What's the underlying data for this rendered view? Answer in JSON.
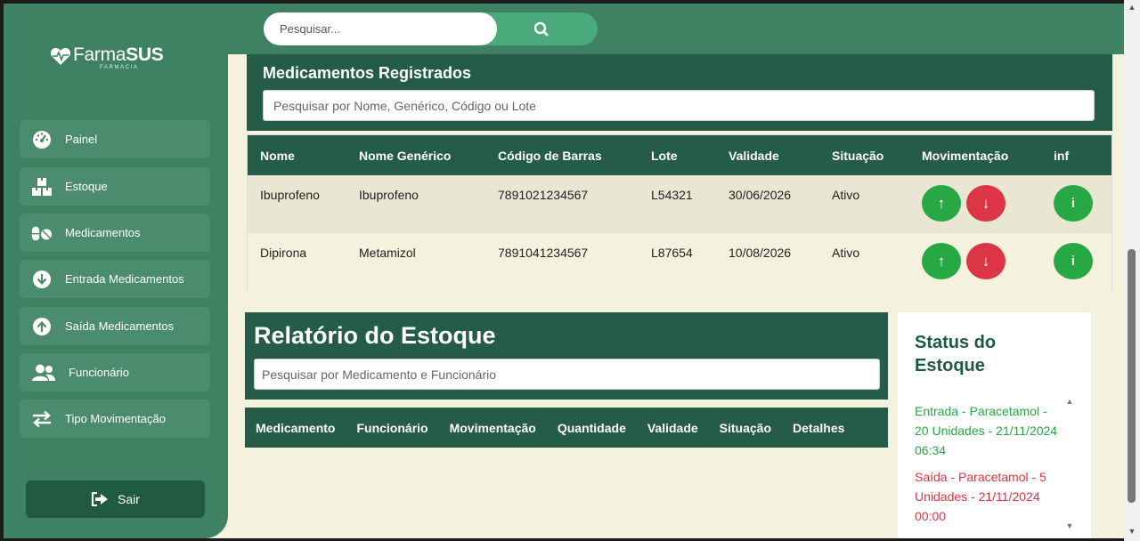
{
  "app": {
    "brand_light": "Farma",
    "brand_bold": "SUS",
    "brand_sub": "FARMÁCIA"
  },
  "topbar": {
    "search_placeholder": "Pesquisar..."
  },
  "sidebar": {
    "items": [
      {
        "label": "Painel",
        "icon": "dashboard-icon"
      },
      {
        "label": "Estoque",
        "icon": "boxes-icon"
      },
      {
        "label": "Medicamentos",
        "icon": "pills-icon"
      },
      {
        "label": "Entrada Medicamentos",
        "icon": "arrow-circle-down-icon"
      },
      {
        "label": "Saída Medicamentos",
        "icon": "arrow-circle-up-icon"
      },
      {
        "label": "Funcionário",
        "icon": "users-icon"
      },
      {
        "label": "Tipo Movimentação",
        "icon": "exchange-icon"
      }
    ],
    "logout_label": "Sair"
  },
  "medicamentos": {
    "title": "Medicamentos Registrados",
    "search_placeholder": "Pesquisar por Nome, Genérico, Código ou Lote",
    "columns": [
      "Nome",
      "Nome Genérico",
      "Código de Barras",
      "Lote",
      "Validade",
      "Situação",
      "Movimentação",
      "inf"
    ],
    "rows": [
      {
        "nome": "Ibuprofeno",
        "generico": "Ibuprofeno",
        "codigo": "7891021234567",
        "lote": "L54321",
        "validade": "30/06/2026",
        "situacao": "Ativo"
      },
      {
        "nome": "Dipirona",
        "generico": "Metamizol",
        "codigo": "7891041234567",
        "lote": "L87654",
        "validade": "10/08/2026",
        "situacao": "Ativo"
      }
    ],
    "up_symbol": "↑",
    "down_symbol": "↓",
    "info_symbol": "i"
  },
  "relatorio": {
    "title": "Relatório do Estoque",
    "search_placeholder": "Pesquisar por Medicamento e Funcionário",
    "columns": [
      "Medicamento",
      "Funcionário",
      "Movimentação",
      "Quantidade",
      "Validade",
      "Situação",
      "Detalhes"
    ]
  },
  "status": {
    "title": "Status do Estoque",
    "entries": [
      {
        "text": "Entrada - Paracetamol - 20 Unidades - 21/11/2024 06:34",
        "type": "entrada"
      },
      {
        "text": "Saída - Paracetamol - 5 Unidades - 21/11/2024 00:00",
        "type": "saida"
      }
    ]
  },
  "colors": {
    "sidebar": "#3f8163",
    "panel": "#245c47",
    "background": "#f4f2dc",
    "success": "#28a745",
    "danger": "#dc3545"
  }
}
